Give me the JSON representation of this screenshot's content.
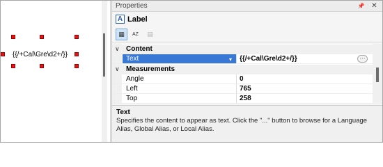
{
  "canvas": {
    "label_text": "{{/+Cal\\Gre\\d2+/}}"
  },
  "panel": {
    "title": "Properties",
    "pin_glyph": "📌",
    "close_glyph": "✕",
    "object": {
      "icon_letter": "A",
      "label": "Label"
    },
    "toolbar": {
      "categorized_glyph": "▦",
      "alphabetical_glyph": "AZ",
      "pages_glyph": "▤"
    }
  },
  "grid": {
    "categories": [
      {
        "name": "Content",
        "chevron": "∨"
      },
      {
        "name": "Measurements",
        "chevron": "∨"
      }
    ],
    "properties": [
      {
        "name": "Text",
        "value": "{{/+Cal\\Gre\\d2+/}}",
        "selected": true,
        "ellipsis": "···"
      },
      {
        "name": "Angle",
        "value": "0"
      },
      {
        "name": "Left",
        "value": "765"
      },
      {
        "name": "Top",
        "value": "258"
      }
    ]
  },
  "description": {
    "title": "Text",
    "text": "Specifies the content to appear as text.  Click the \"...\" button to browse for a Language Alias, Global Alias, or Local Alias."
  },
  "colors": {
    "selection": "#3a78d6",
    "handle": "#e21414",
    "icon_blue": "#2a5bb5"
  }
}
